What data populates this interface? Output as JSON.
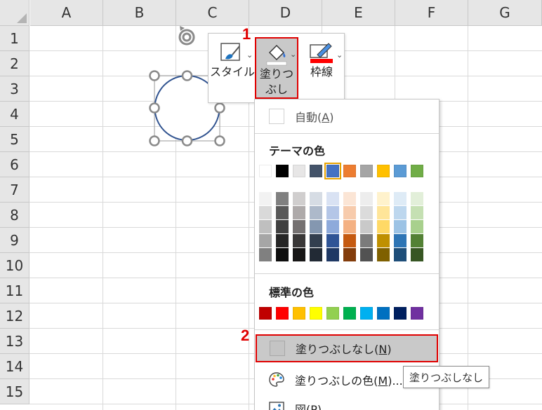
{
  "sheet": {
    "columns": [
      "A",
      "B",
      "C",
      "D",
      "E",
      "F",
      "G"
    ],
    "rows": [
      "1",
      "2",
      "3",
      "4",
      "5",
      "6",
      "7",
      "8",
      "9",
      "10",
      "11",
      "12",
      "13",
      "14",
      "15"
    ]
  },
  "toolbar": {
    "style_label": "スタイル",
    "fill_label_line1": "塗りつ",
    "fill_label_line2": "ぶし",
    "border_label": "枠線"
  },
  "steps": {
    "step1": "1",
    "step2": "2"
  },
  "menu": {
    "auto_label": "自動(",
    "auto_accel": "A",
    "auto_tail": ")",
    "theme_title": "テーマの色",
    "standard_title": "標準の色",
    "no_fill_label": "塗りつぶしなし(",
    "no_fill_accel": "N",
    "no_fill_tail": ")",
    "more_label": "塗りつぶしの色(",
    "more_accel": "M",
    "more_tail": ")...",
    "picture_label": "図(",
    "picture_accel": "P",
    "picture_tail": ")"
  },
  "tooltip": "塗りつぶしなし",
  "colors": {
    "theme_top": [
      "#FFFFFF",
      "#000000",
      "#E7E6E6",
      "#44546A",
      "#4472C4",
      "#ED7D31",
      "#A5A5A5",
      "#FFC000",
      "#5B9BD5",
      "#70AD47"
    ],
    "theme_shades": [
      [
        "#F2F2F2",
        "#D9D9D9",
        "#BFBFBF",
        "#A6A6A6",
        "#808080"
      ],
      [
        "#808080",
        "#595959",
        "#404040",
        "#262626",
        "#0D0D0D"
      ],
      [
        "#D0CECE",
        "#AEAAAA",
        "#757171",
        "#3A3838",
        "#171616"
      ],
      [
        "#D6DCE4",
        "#ADB9CA",
        "#8497B0",
        "#333F4F",
        "#222A35"
      ],
      [
        "#D9E2F3",
        "#B4C6E7",
        "#8EAADB",
        "#2F5496",
        "#1F3864"
      ],
      [
        "#FBE5D5",
        "#F7CBAC",
        "#F4B183",
        "#C55A11",
        "#833C0B"
      ],
      [
        "#EDEDED",
        "#DBDBDB",
        "#C9C9C9",
        "#7B7B7B",
        "#525252"
      ],
      [
        "#FFF2CC",
        "#FFE599",
        "#FFD966",
        "#BF9000",
        "#7F6000"
      ],
      [
        "#DEEBF6",
        "#BDD7EE",
        "#9CC3E5",
        "#2E75B5",
        "#1E4E79"
      ],
      [
        "#E2EFD9",
        "#C5E0B3",
        "#A8D08D",
        "#538135",
        "#375623"
      ]
    ],
    "standard": [
      "#C00000",
      "#FF0000",
      "#FFC000",
      "#FFFF00",
      "#92D050",
      "#00B050",
      "#00B0F0",
      "#0070C0",
      "#002060",
      "#7030A0"
    ],
    "highlight_red": "#E00000",
    "selected_gray": "#C9C9C9"
  }
}
